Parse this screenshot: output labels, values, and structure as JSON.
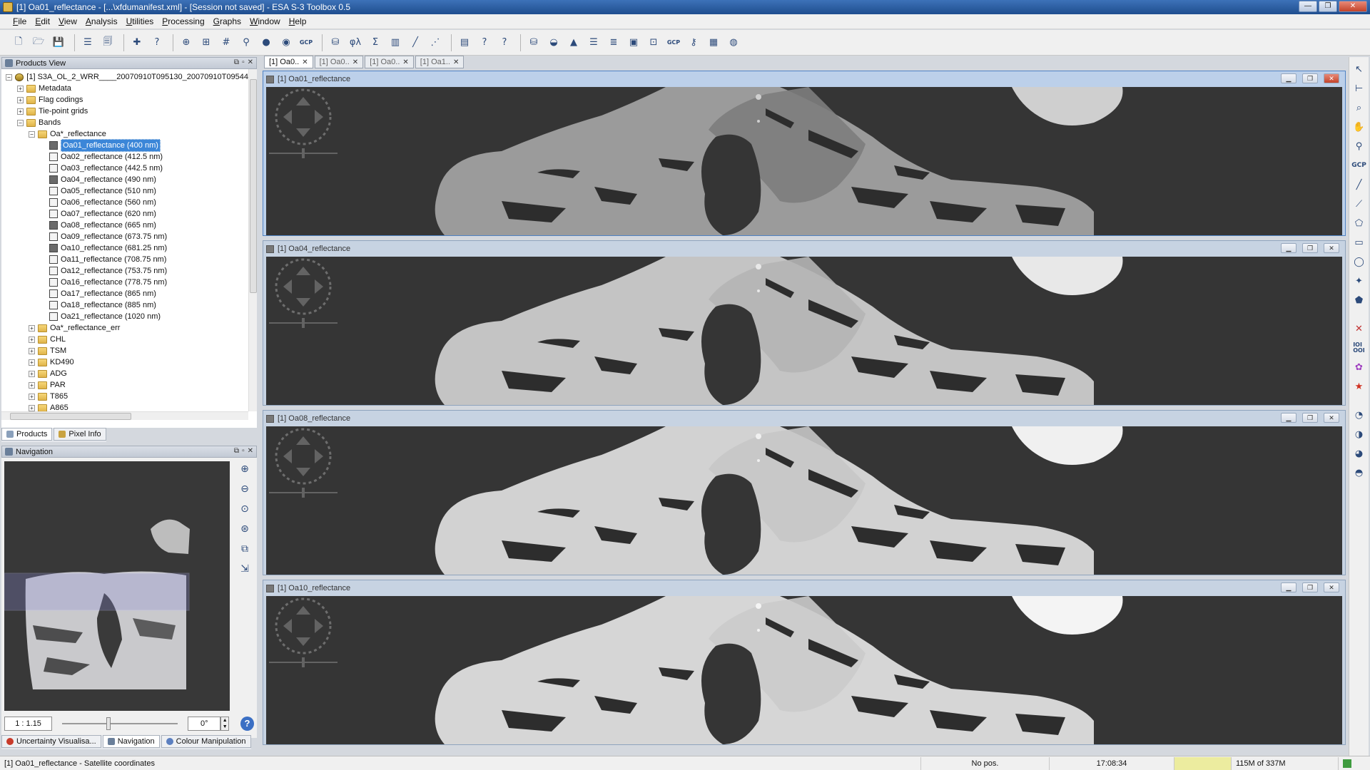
{
  "window": {
    "title": "[1] Oa01_reflectance - [...\\xfdumanifest.xml] - [Session not saved] - ESA S-3 Toolbox 0.5",
    "controls": [
      "—",
      "❐",
      "✕"
    ]
  },
  "menu": [
    {
      "key": "F",
      "rest": "ile"
    },
    {
      "key": "E",
      "rest": "dit"
    },
    {
      "key": "V",
      "rest": "iew"
    },
    {
      "key": "A",
      "rest": "nalysis"
    },
    {
      "key": "U",
      "rest": "tilities"
    },
    {
      "key": "P",
      "rest": "rocessing"
    },
    {
      "key": "G",
      "rest": "raphs"
    },
    {
      "key": "W",
      "rest": "indow"
    },
    {
      "key": "H",
      "rest": "elp"
    }
  ],
  "toolbar": {
    "gcp_label": "GCP",
    "gcp2_label": "GCP",
    "icons": [
      "new-product-icon",
      "open-product-icon",
      "save-product-icon",
      "properties-icon",
      "export-icon",
      "plugin-icon",
      "help-icon",
      "world-map-icon",
      "mask-manager-icon",
      "graticule-icon",
      "pin-icon",
      "shape-icon",
      "placemark-icon",
      "gcp-manager-icon",
      "band-maths-icon",
      "spectrum-icon",
      "sigma-icon",
      "histogram-icon",
      "scatter-icon",
      "profile-icon",
      "statistics-icon",
      "information-icon",
      "query-icon",
      "layers-icon",
      "terrain-icon",
      "pyramid-icon",
      "stack-icon",
      "mosaic-icon",
      "subset-icon",
      "reproject-icon",
      "gcp-tool-icon",
      "magic-wand-icon",
      "time-series-icon",
      "globe-icon"
    ]
  },
  "products_view": {
    "title": "Products View",
    "tree": [
      {
        "level": 0,
        "exp": "−",
        "type": "prod",
        "label": "[1]  S3A_OL_2_WRR____20070910T095130_20070910T09544"
      },
      {
        "level": 1,
        "exp": "+",
        "type": "folder",
        "label": "Metadata"
      },
      {
        "level": 1,
        "exp": "+",
        "type": "folder",
        "label": "Flag codings"
      },
      {
        "level": 1,
        "exp": "+",
        "type": "folder",
        "label": "Tie-point grids"
      },
      {
        "level": 1,
        "exp": "−",
        "type": "folder",
        "label": "Bands"
      },
      {
        "level": 2,
        "exp": "−",
        "type": "folder",
        "label": "Oa*_reflectance"
      },
      {
        "level": 3,
        "exp": "",
        "type": "band open",
        "label": "Oa01_reflectance (400 nm)",
        "selected": true
      },
      {
        "level": 3,
        "exp": "",
        "type": "band",
        "label": "Oa02_reflectance (412.5 nm)"
      },
      {
        "level": 3,
        "exp": "",
        "type": "band",
        "label": "Oa03_reflectance (442.5 nm)"
      },
      {
        "level": 3,
        "exp": "",
        "type": "band open",
        "label": "Oa04_reflectance (490 nm)"
      },
      {
        "level": 3,
        "exp": "",
        "type": "band",
        "label": "Oa05_reflectance (510 nm)"
      },
      {
        "level": 3,
        "exp": "",
        "type": "band",
        "label": "Oa06_reflectance (560 nm)"
      },
      {
        "level": 3,
        "exp": "",
        "type": "band",
        "label": "Oa07_reflectance (620 nm)"
      },
      {
        "level": 3,
        "exp": "",
        "type": "band open",
        "label": "Oa08_reflectance (665 nm)"
      },
      {
        "level": 3,
        "exp": "",
        "type": "band",
        "label": "Oa09_reflectance (673.75 nm)"
      },
      {
        "level": 3,
        "exp": "",
        "type": "band open",
        "label": "Oa10_reflectance (681.25 nm)"
      },
      {
        "level": 3,
        "exp": "",
        "type": "band",
        "label": "Oa11_reflectance (708.75 nm)"
      },
      {
        "level": 3,
        "exp": "",
        "type": "band",
        "label": "Oa12_reflectance (753.75 nm)"
      },
      {
        "level": 3,
        "exp": "",
        "type": "band",
        "label": "Oa16_reflectance (778.75 nm)"
      },
      {
        "level": 3,
        "exp": "",
        "type": "band",
        "label": "Oa17_reflectance (865 nm)"
      },
      {
        "level": 3,
        "exp": "",
        "type": "band",
        "label": "Oa18_reflectance (885 nm)"
      },
      {
        "level": 3,
        "exp": "",
        "type": "band",
        "label": "Oa21_reflectance (1020 nm)"
      },
      {
        "level": 2,
        "exp": "+",
        "type": "folder",
        "label": "Oa*_reflectance_err"
      },
      {
        "level": 2,
        "exp": "+",
        "type": "folder",
        "label": "CHL"
      },
      {
        "level": 2,
        "exp": "+",
        "type": "folder",
        "label": "TSM"
      },
      {
        "level": 2,
        "exp": "+",
        "type": "folder",
        "label": "KD490"
      },
      {
        "level": 2,
        "exp": "+",
        "type": "folder",
        "label": "ADG"
      },
      {
        "level": 2,
        "exp": "+",
        "type": "folder",
        "label": "PAR"
      },
      {
        "level": 2,
        "exp": "+",
        "type": "folder",
        "label": "T865"
      },
      {
        "level": 2,
        "exp": "+",
        "type": "folder",
        "label": "A865"
      }
    ]
  },
  "left_tabs": [
    {
      "label": "Products",
      "active": true
    },
    {
      "label": "Pixel Info",
      "active": false
    }
  ],
  "navigation": {
    "title": "Navigation",
    "scale": "1 : 1.15",
    "rotation": "0°",
    "zoom_slider_position": 0.38
  },
  "bottom_tabs": [
    {
      "label": "Uncertainty Visualisa...",
      "active": false
    },
    {
      "label": "Navigation",
      "active": true
    },
    {
      "label": "Colour Manipulation",
      "active": false
    }
  ],
  "doc_tabs": [
    {
      "label": "[1] Oa0..",
      "active": true
    },
    {
      "label": "[1] Oa0..",
      "active": false
    },
    {
      "label": "[1] Oa0..",
      "active": false
    },
    {
      "label": "[1] Oa1..",
      "active": false
    }
  ],
  "image_windows": [
    {
      "title": "[1] Oa01_reflectance",
      "active": true
    },
    {
      "title": "[1] Oa04_reflectance",
      "active": false
    },
    {
      "title": "[1] Oa08_reflectance",
      "active": false
    },
    {
      "title": "[1] Oa10_reflectance",
      "active": false
    }
  ],
  "status": {
    "message": "[1] Oa01_reflectance - Satellite coordinates",
    "position": "No pos.",
    "time": "17:08:34",
    "memory": "115M of 337M"
  }
}
